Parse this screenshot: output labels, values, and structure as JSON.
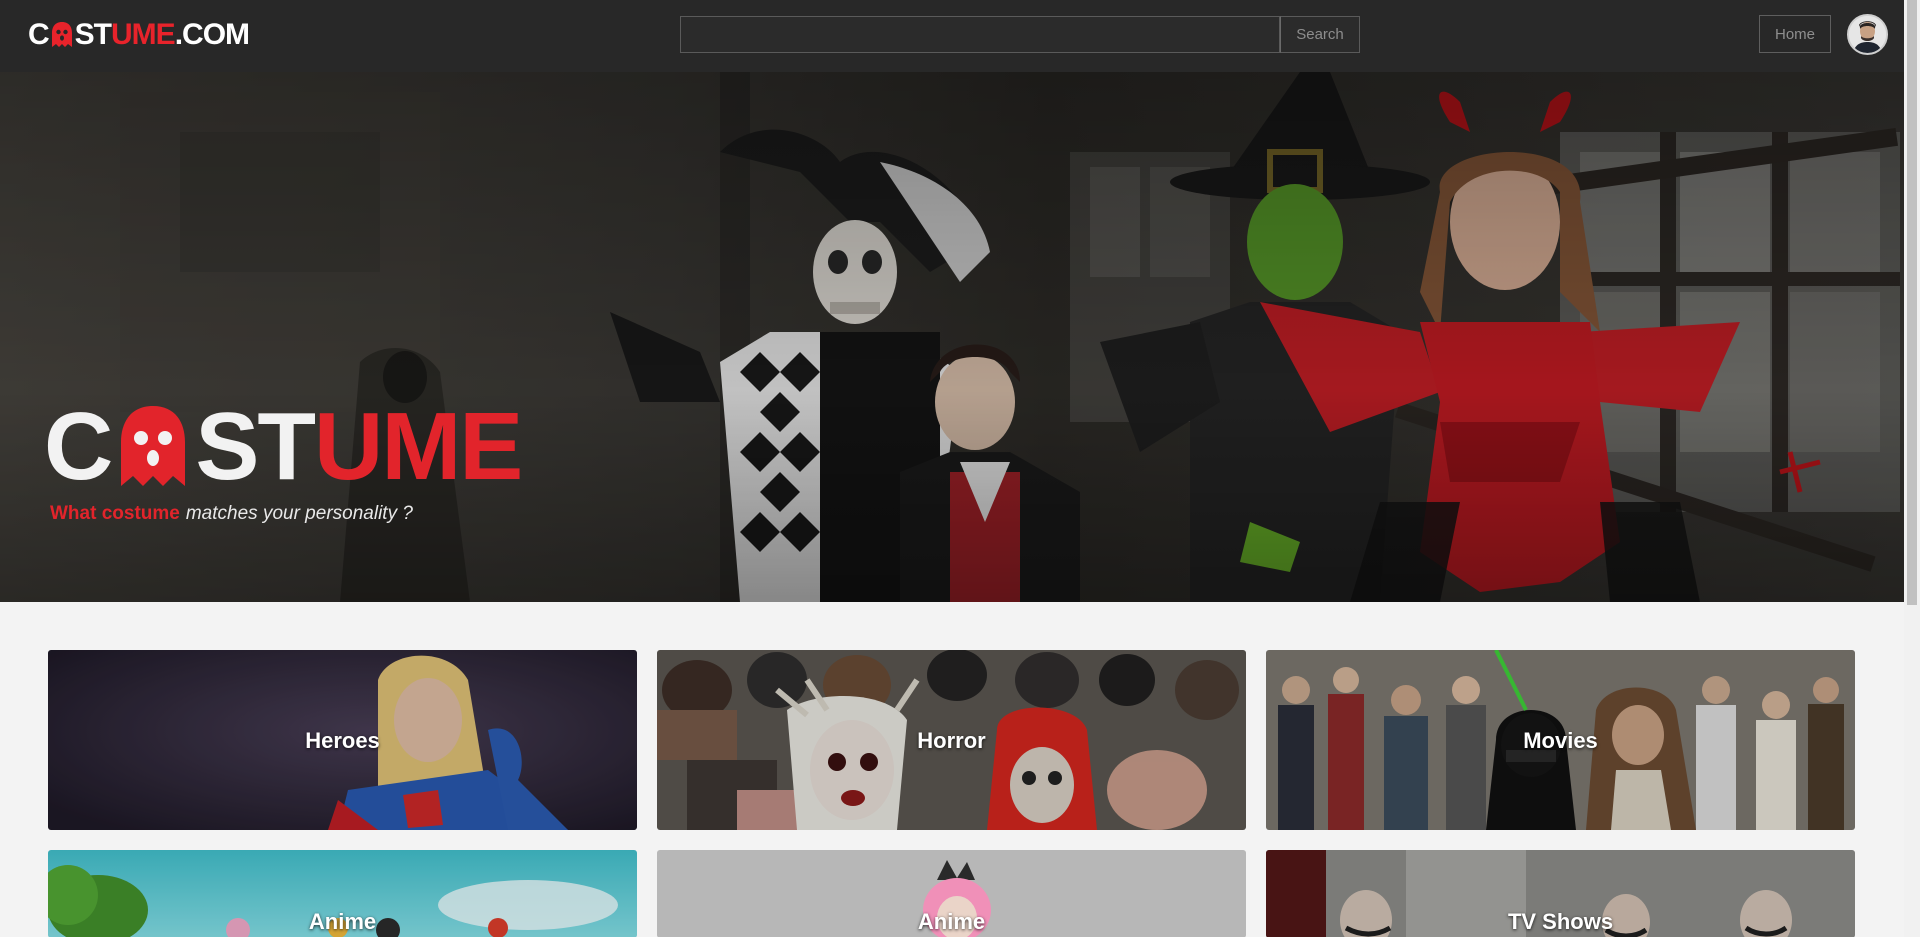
{
  "header": {
    "logo": {
      "part1": "C",
      "part2": "ST",
      "part3": "UME",
      "part4": ".COM",
      "icon": "ghost-icon"
    },
    "search": {
      "placeholder": "",
      "value": "",
      "button_label": "Search"
    },
    "nav": {
      "home_label": "Home"
    },
    "avatar": {
      "icon": "user-avatar"
    }
  },
  "hero": {
    "title": {
      "part1": "C",
      "part2": "ST",
      "part3": "UME",
      "icon": "ghost-icon"
    },
    "subtitle_red": "What costume",
    "subtitle_white": "matches your personality ?"
  },
  "categories": [
    {
      "label": "Heroes"
    },
    {
      "label": "Horror"
    },
    {
      "label": "Movies"
    },
    {
      "label": "Anime"
    },
    {
      "label": "Anime"
    },
    {
      "label": "TV Shows"
    }
  ],
  "colors": {
    "navbar_bg": "#282828",
    "accent_red": "#e2242b",
    "page_bg": "#f3f3f3"
  }
}
